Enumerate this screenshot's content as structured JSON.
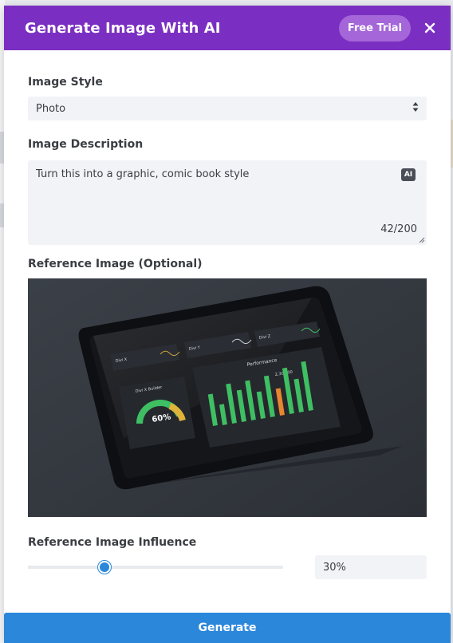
{
  "header": {
    "title": "Generate Image With AI",
    "badge": "Free Trial",
    "close_icon": "close-icon"
  },
  "form": {
    "style_label": "Image Style",
    "style_value": "Photo",
    "description_label": "Image Description",
    "description_value": "Turn this into a graphic, comic book style",
    "ai_badge": "AI",
    "char_count": "42/200",
    "reference_label": "Reference Image (Optional)",
    "influence_label": "Reference Image Influence",
    "influence_value": "30%",
    "influence_fraction": 0.3,
    "generate_label": "Generate"
  },
  "reference_image": {
    "widgets": [
      {
        "title": "Divi X"
      },
      {
        "title": "Divi Y"
      },
      {
        "title": "Divi Z"
      }
    ],
    "gauge_title": "Divi X Builder",
    "gauge_value": "60%",
    "chart_title": "Performance",
    "chart_value": "2,300.00"
  },
  "colors": {
    "header": "#7b2fc2",
    "badge": "#a466d8",
    "accent": "#2b87da",
    "field_bg": "#f1f3f6"
  }
}
